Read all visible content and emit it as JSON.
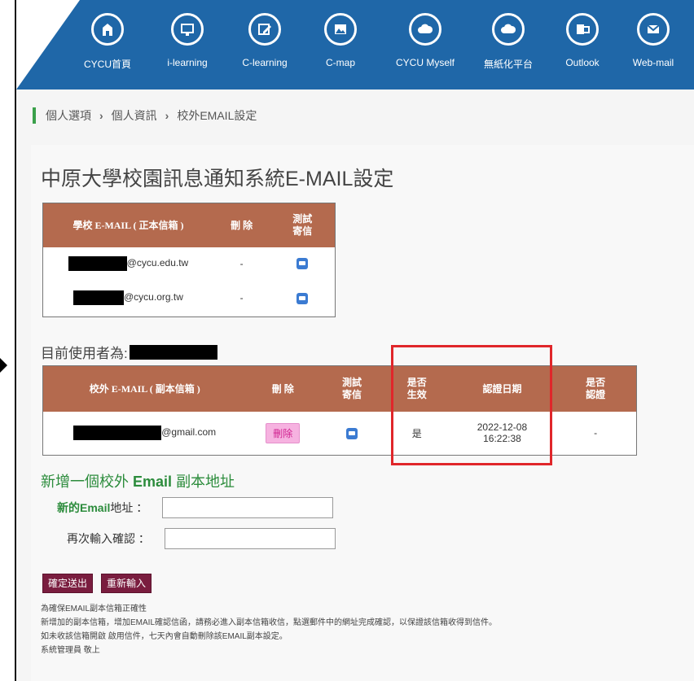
{
  "nav": {
    "items": [
      {
        "label": "CYCU首頁",
        "icon": "home-icon"
      },
      {
        "label": "i-learning",
        "icon": "monitor-icon"
      },
      {
        "label": "C-learning",
        "icon": "edit-icon"
      },
      {
        "label": "C-map",
        "icon": "mountain-icon"
      },
      {
        "label": "CYCU Myself",
        "icon": "cloud-icon"
      },
      {
        "label": "無紙化平台",
        "icon": "cloud-upload-icon"
      },
      {
        "label": "Outlook",
        "icon": "outlook-icon"
      },
      {
        "label": "Web-mail",
        "icon": "mail-icon"
      }
    ]
  },
  "breadcrumb": [
    "個人選項",
    "個人資訊",
    "校外EMAIL設定"
  ],
  "page_title": "中原大學校園訊息通知系統E-MAIL設定",
  "school_table": {
    "headers": [
      "學校 E-MAIL ( 正本信箱 )",
      "刪 除",
      "測試寄信"
    ],
    "rows": [
      {
        "email": "@cycu.edu.tw",
        "delete": "-"
      },
      {
        "email": "@cycu.org.tw",
        "delete": "-"
      }
    ]
  },
  "current_user_label": "目前使用者為:",
  "external_table": {
    "headers": [
      "校外 E-MAIL ( 副本信箱 )",
      "刪 除",
      "測試寄信",
      "是否生效",
      "認證日期",
      "是否認證"
    ],
    "rows": [
      {
        "email": "@gmail.com",
        "delete": "刪除",
        "effective": "是",
        "date": "2022-12-08",
        "time": "16:22:38",
        "verified": "-"
      }
    ]
  },
  "add_form": {
    "title_prefix": "新增一個校外",
    "title_bold": "Email",
    "title_suffix": "副本地址",
    "new_email_label_bold": "新的Email",
    "new_email_label_rest": "地址 ：",
    "confirm_label": "再次輸入確認 ：",
    "submit": "確定送出",
    "reset": "重新輸入"
  },
  "notes": [
    "為確保EMAIL副本信箱正確性",
    "新增加的副本信箱，增加EMAIL確認信函，請務必進入副本信箱收信，點選郵件中的網址完成確認，以保證該信箱收得到信件。",
    "如未收該信箱開啟 啟用信件，七天內會自動刪除該EMAIL副本設定。",
    "系統管理員 敬上"
  ],
  "colors": {
    "nav_blue": "#1f67a8",
    "table_header": "#b46a4e",
    "highlight": "#e0262a",
    "green": "#2c8c3c"
  }
}
